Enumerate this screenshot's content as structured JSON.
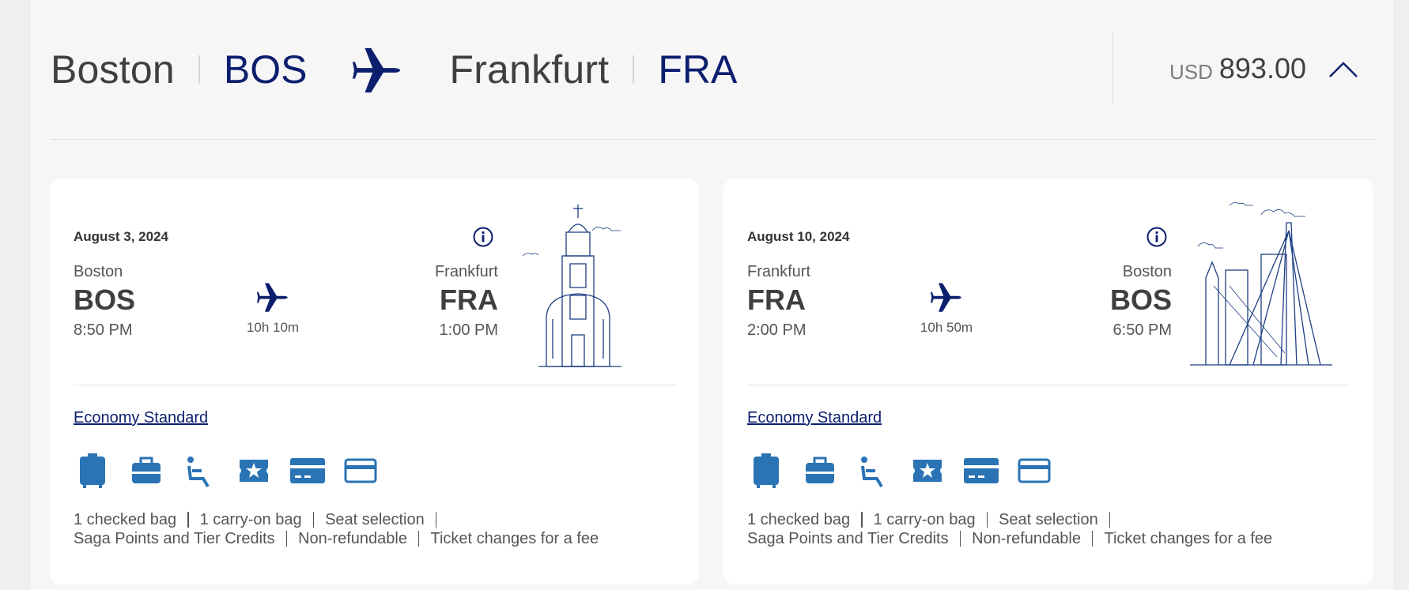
{
  "trip": {
    "origin_city": "Boston",
    "origin_code": "BOS",
    "destination_city": "Frankfurt",
    "destination_code": "FRA",
    "currency": "USD",
    "amount": "893.00",
    "icons": {
      "plane": "airplane-icon",
      "collapse": "chevron-up-icon"
    }
  },
  "colors": {
    "brand": "#0c1e6e",
    "icon": "#2a73b5",
    "text": "#3f3f3f"
  },
  "flights": [
    {
      "date": "August 3, 2024",
      "dep_city": "Boston",
      "dep_code": "BOS",
      "dep_time": "8:50 PM",
      "arr_city": "Frankfurt",
      "arr_code": "FRA",
      "arr_time": "1:00 PM",
      "duration": "10h 10m",
      "fare": "Economy Standard",
      "illustration": "frankfurt-church-illustration",
      "features_row1": [
        "1 checked bag",
        "1 carry-on bag",
        "Seat selection"
      ],
      "features_row2": [
        "Saga Points and Tier Credits",
        "Non-refundable",
        "Ticket changes for a fee"
      ]
    },
    {
      "date": "August 10, 2024",
      "dep_city": "Frankfurt",
      "dep_code": "FRA",
      "dep_time": "2:00 PM",
      "arr_city": "Boston",
      "arr_code": "BOS",
      "arr_time": "6:50 PM",
      "duration": "10h 50m",
      "fare": "Economy Standard",
      "illustration": "boston-skyline-illustration",
      "features_row1": [
        "1 checked bag",
        "1 carry-on bag",
        "Seat selection"
      ],
      "features_row2": [
        "Saga Points and Tier Credits",
        "Non-refundable",
        "Ticket changes for a fee"
      ]
    }
  ],
  "fare_icons": [
    "checked-bag-icon",
    "carry-on-bag-icon",
    "seat-icon",
    "points-ticket-icon",
    "refund-card-icon",
    "change-card-icon"
  ]
}
